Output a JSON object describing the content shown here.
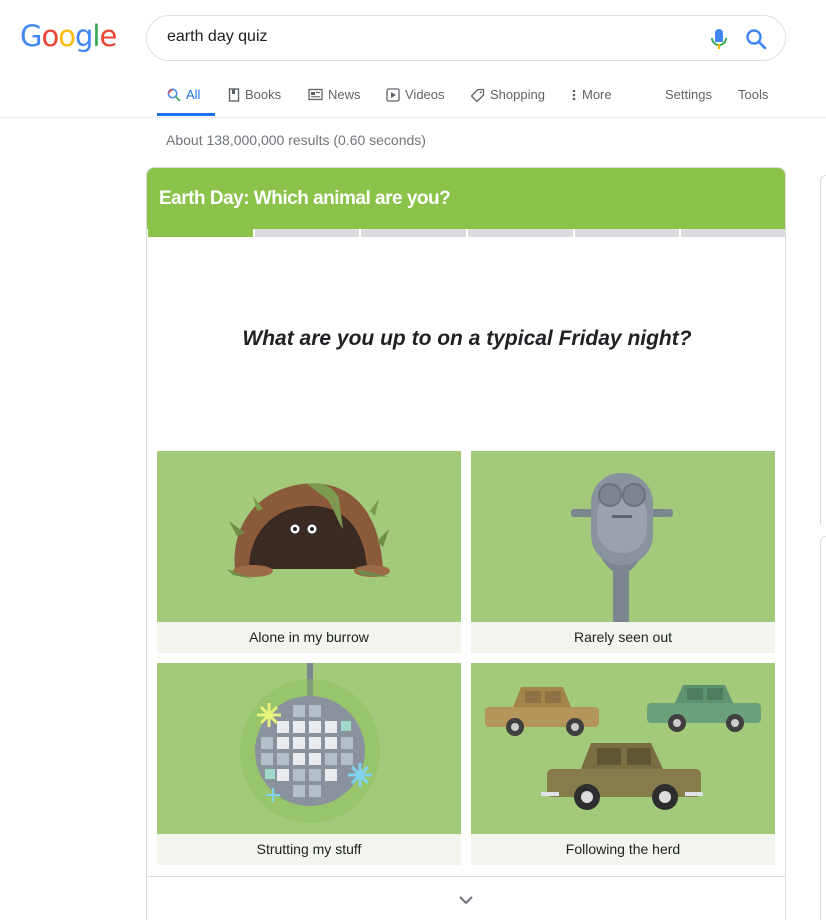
{
  "logo": {
    "letters": [
      {
        "char": "G",
        "color": "#4285f4"
      },
      {
        "char": "o",
        "color": "#ea4335"
      },
      {
        "char": "o",
        "color": "#fbbc05"
      },
      {
        "char": "g",
        "color": "#4285f4"
      },
      {
        "char": "l",
        "color": "#34a853"
      },
      {
        "char": "e",
        "color": "#ea4335"
      }
    ]
  },
  "search": {
    "query": "earth day quiz",
    "mic_icon": "microphone-icon",
    "search_icon": "magnifier-icon"
  },
  "tabs": {
    "all": "All",
    "books": "Books",
    "news": "News",
    "videos": "Videos",
    "shopping": "Shopping",
    "more": "More",
    "settings": "Settings",
    "tools": "Tools"
  },
  "result_stats": "About 138,000,000 results (0.60 seconds)",
  "quiz": {
    "title": "Earth Day: Which animal are you?",
    "accent_color": "#8bc34a",
    "progress": {
      "current": 1,
      "total": 6
    },
    "question": "What are you up to on a typical Friday night?",
    "options": [
      {
        "label": "Alone in my burrow",
        "icon": "burrow-icon"
      },
      {
        "label": "Rarely seen out",
        "icon": "binoculars-viewer-icon"
      },
      {
        "label": "Strutting my stuff",
        "icon": "disco-ball-icon"
      },
      {
        "label": "Following the herd",
        "icon": "cars-icon"
      }
    ],
    "expand_icon": "chevron-down-icon"
  }
}
